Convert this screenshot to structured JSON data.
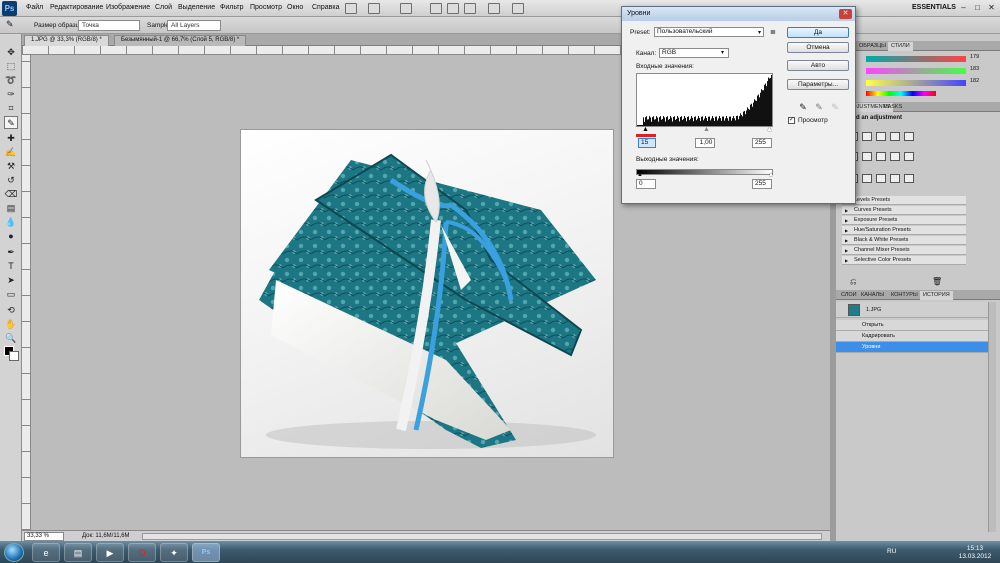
{
  "menubar": {
    "logo": "Ps",
    "items": [
      "Файл",
      "Редактирование",
      "Изображение",
      "Слой",
      "Выделение",
      "Фильтр",
      "Просмотр",
      "Окно",
      "Справка"
    ],
    "workspace": "ESSENTIALS"
  },
  "options": {
    "sample_size_label": "Размер образца:",
    "sample_size_value": "Точка",
    "sample_label": "Sample:",
    "sample_value": "All Layers"
  },
  "doc_tabs": [
    {
      "label": "1.JPG @ 33,3% (RGB/8) *",
      "active": true
    },
    {
      "label": "Безымянный-1 @ 66,7% (Слой 5, RGB/8) *",
      "active": false
    }
  ],
  "status": {
    "zoom": "33,33 %",
    "doc_size": "Док: 11,6M/11,6M"
  },
  "panels": {
    "top_tabs": [
      "ОБРАЗЦЫ",
      "СТИЛИ"
    ],
    "slider_values": [
      "179",
      "183",
      "182"
    ],
    "adj_tabs": [
      "ADJUSTMENTS",
      "MASKS"
    ],
    "adj_title": "Add an adjustment",
    "presets": [
      "Levels Presets",
      "Curves Presets",
      "Exposure Presets",
      "Hue/Saturation Presets",
      "Black & White Presets",
      "Channel Mixer Presets",
      "Selective Color Presets"
    ],
    "layer_tabs": [
      "СЛОИ",
      "КАНАЛЫ",
      "КОНТУРЫ",
      "ИСТОРИЯ"
    ],
    "history_snapshot": "1.JPG",
    "history": [
      {
        "label": "Открыть",
        "selected": false
      },
      {
        "label": "Кадрировать",
        "selected": false
      },
      {
        "label": "Уровни",
        "selected": true
      }
    ]
  },
  "dialog": {
    "title": "Уровни",
    "preset_label": "Preset:",
    "preset_value": "Пользовательский",
    "channel_label": "Канал:",
    "channel_value": "RGB",
    "input_label": "Входные значения:",
    "input_values": [
      "15",
      "1,00",
      "255"
    ],
    "output_label": "Выходные значения:",
    "output_values": [
      "0",
      "255"
    ],
    "buttons": {
      "ok": "Да",
      "cancel": "Отмена",
      "auto": "Авто",
      "options": "Параметры..."
    },
    "preview_label": "Просмотр",
    "preview_checked": true
  },
  "taskbar": {
    "language": "RU",
    "time": "15:13",
    "date": "13.03.2012"
  },
  "colors": {
    "accent": "#3d8ee8",
    "photo_fabric": "#1f7d88",
    "ribbon": "#3aa0e0",
    "marker": "#e02020"
  }
}
